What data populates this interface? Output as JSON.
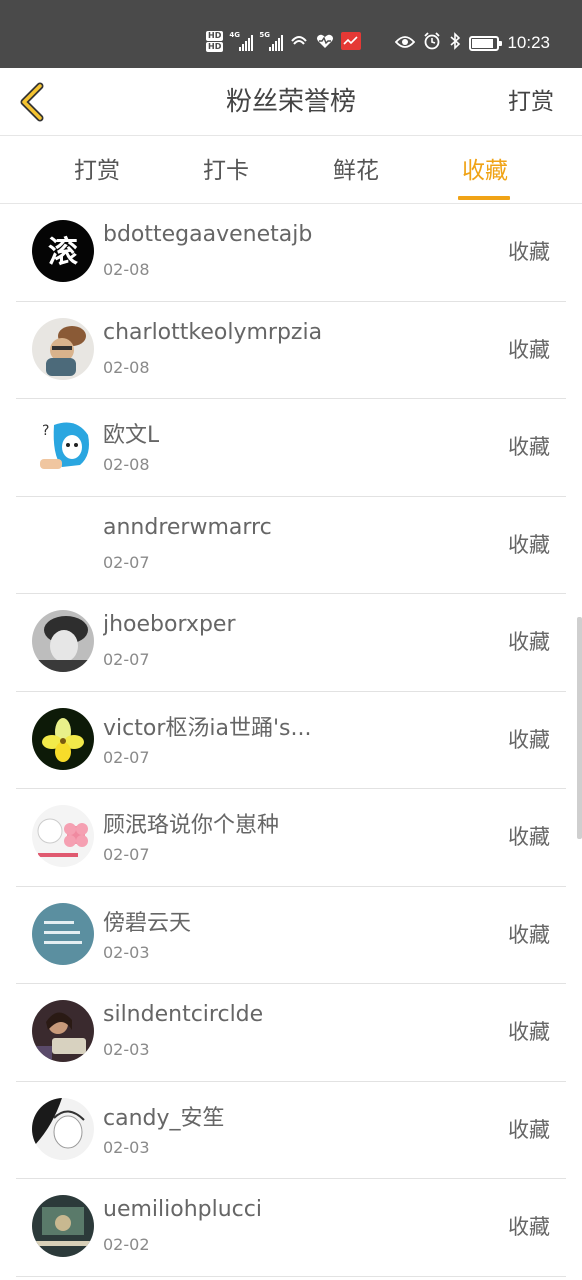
{
  "status_bar": {
    "hd1": "HD",
    "hd2": "HD",
    "net1": "4G",
    "net2": "5G",
    "time": "10:23",
    "battery_level": 0.85
  },
  "header": {
    "title": "粉丝荣誉榜",
    "action": "打赏"
  },
  "tabs": [
    "打赏",
    "打卡",
    "鲜花",
    "收藏"
  ],
  "active_tab": 3,
  "colors": {
    "accent": "#f0a316",
    "statusbar": "#4a4a4a"
  },
  "rows": [
    {
      "name": "bdottegaavenetajb",
      "date": "02-08",
      "action": "收藏",
      "avatar": "black-logo-avatar"
    },
    {
      "name": "charlottkeolymrpzia",
      "date": "02-08",
      "action": "收藏",
      "avatar": "cartoon-warrior-avatar"
    },
    {
      "name": "欧文L",
      "date": "02-08",
      "action": "收藏",
      "avatar": "blue-hair-cartoon-avatar"
    },
    {
      "name": "anndrerwmarrc",
      "date": "02-07",
      "action": "收藏",
      "avatar": "blank-avatar"
    },
    {
      "name": "jhoeborxper",
      "date": "02-07",
      "action": "收藏",
      "avatar": "grayscale-photo-avatar"
    },
    {
      "name": "victor枢汤ia世踊's...",
      "date": "02-07",
      "action": "收藏",
      "avatar": "yellow-flower-avatar"
    },
    {
      "name": "顾泯珞说你个崽种",
      "date": "02-07",
      "action": "收藏",
      "avatar": "pink-flower-avatar"
    },
    {
      "name": "傍碧云天",
      "date": "02-03",
      "action": "收藏",
      "avatar": "teal-text-avatar"
    },
    {
      "name": "silndentcirclde",
      "date": "02-03",
      "action": "收藏",
      "avatar": "reading-girl-avatar"
    },
    {
      "name": "candy_安笙",
      "date": "02-03",
      "action": "收藏",
      "avatar": "anime-sketch-avatar"
    },
    {
      "name": "uemiliohplucci",
      "date": "02-02",
      "action": "收藏",
      "avatar": "dark-scene-avatar"
    }
  ]
}
